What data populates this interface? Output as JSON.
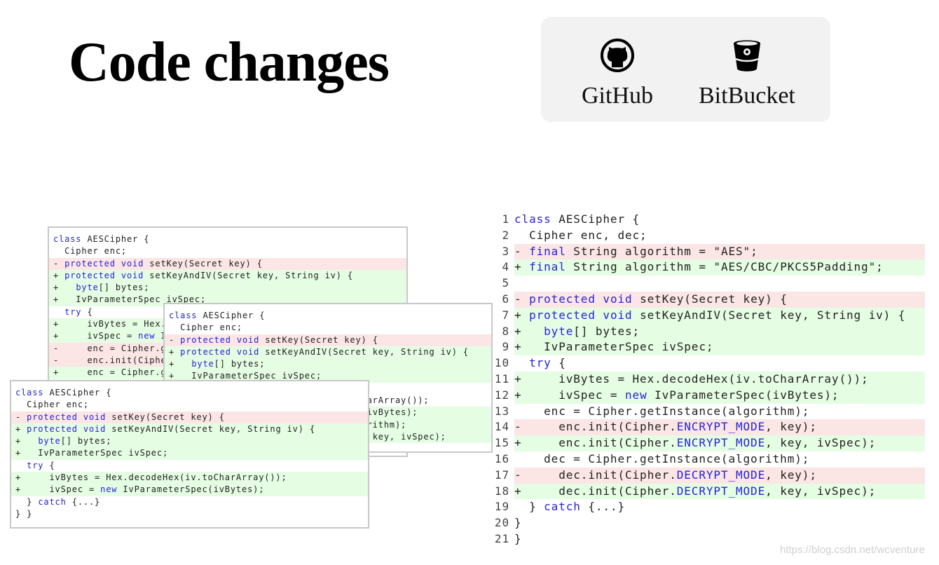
{
  "title": "Code changes",
  "links": [
    {
      "label": "GitHub",
      "icon": "github-icon"
    },
    {
      "label": "BitBucket",
      "icon": "bitbucket-icon"
    }
  ],
  "colors": {
    "deleted_bg": "#fbe5e5",
    "added_bg": "#e5fde3",
    "keyword": "#2424d8"
  },
  "keywords": [
    "class",
    "protected",
    "void",
    "final",
    "byte",
    "new",
    "try",
    "catch",
    "ENCRYPT_MODE",
    "DECRYPT_MODE"
  ],
  "cards": [
    {
      "lines": [
        "  class AESCipher {",
        "    Cipher enc;",
        "- protected void setKey(Secret key) {",
        "+ protected void setKeyAndIV(Secret key, String iv) {",
        "+   byte[] bytes;",
        "+   IvParameterSpec ivSpec;",
        "    try {",
        "+     ivBytes = Hex.decodeHex(iv.toCharArray());",
        "+     ivSpec = new IvParameterSpec(ivBytes);",
        "-     enc = Cipher.getInstance(\"AES\");",
        "-     enc.init(Cipher.ENCRYPT_MODE, key);",
        "+     enc = Cipher.getInstance(\"AES/CBC/PKCS5Padding\");"
      ]
    },
    {
      "lines": [
        "  class AESCipher {",
        "    Cipher enc;",
        "- protected void setKey(Secret key) {",
        "+ protected void setKeyAndIV(Secret key, String iv) {",
        "+   byte[] bytes;",
        "+   IvParameterSpec ivSpec;",
        "    try {",
        "      ivBytes = Hex.decodeHex(iv.toCharArray());",
        "+     ivSpec = new IvParameterSpec(ivBytes);",
        "+     enc = Cipher.getInstance(algorithm);",
        "+     enc.init(Cipher.ENCRYPT_MODE, key, ivSpec);"
      ]
    },
    {
      "lines": [
        "  class AESCipher {",
        "    Cipher enc;",
        "- protected void setKey(Secret key) {",
        "+ protected void setKeyAndIV(Secret key, String iv) {",
        "+   byte[] bytes;",
        "+   IvParameterSpec ivSpec;",
        "    try {",
        "+     ivBytes = Hex.decodeHex(iv.toCharArray());",
        "+     ivSpec = new IvParameterSpec(ivBytes);",
        "    } catch {...}",
        "  } }"
      ]
    }
  ],
  "main_code": [
    {
      "n": "1",
      "text": "  class AESCipher {"
    },
    {
      "n": "2",
      "text": "    Cipher enc, dec;"
    },
    {
      "n": "3",
      "text": "- final String algorithm = \"AES\";"
    },
    {
      "n": "4",
      "text": "+ final String algorithm = \"AES/CBC/PKCS5Padding\";"
    },
    {
      "n": "5",
      "text": ""
    },
    {
      "n": "6",
      "text": "- protected void setKey(Secret key) {"
    },
    {
      "n": "7",
      "text": "+ protected void setKeyAndIV(Secret key, String iv) {"
    },
    {
      "n": "8",
      "text": "+   byte[] bytes;"
    },
    {
      "n": "9",
      "text": "+   IvParameterSpec ivSpec;"
    },
    {
      "n": "10",
      "text": "    try {"
    },
    {
      "n": "11",
      "text": "+     ivBytes = Hex.decodeHex(iv.toCharArray());"
    },
    {
      "n": "12",
      "text": "+     ivSpec = new IvParameterSpec(ivBytes);"
    },
    {
      "n": "13",
      "text": "      enc = Cipher.getInstance(algorithm);"
    },
    {
      "n": "14",
      "text": "-     enc.init(Cipher.ENCRYPT_MODE, key);"
    },
    {
      "n": "15",
      "text": "+     enc.init(Cipher.ENCRYPT_MODE, key, ivSpec);"
    },
    {
      "n": "16",
      "text": "      dec = Cipher.getInstance(algorithm);"
    },
    {
      "n": "17",
      "text": "-     dec.init(Cipher.DECRYPT_MODE, key);"
    },
    {
      "n": "18",
      "text": "+     dec.init(Cipher.DECRYPT_MODE, key, ivSpec);"
    },
    {
      "n": "19",
      "text": "    } catch {...}"
    },
    {
      "n": "20",
      "text": "  }"
    },
    {
      "n": "21",
      "text": "}"
    }
  ],
  "watermark": "https://blog.csdn.net/wcventure"
}
